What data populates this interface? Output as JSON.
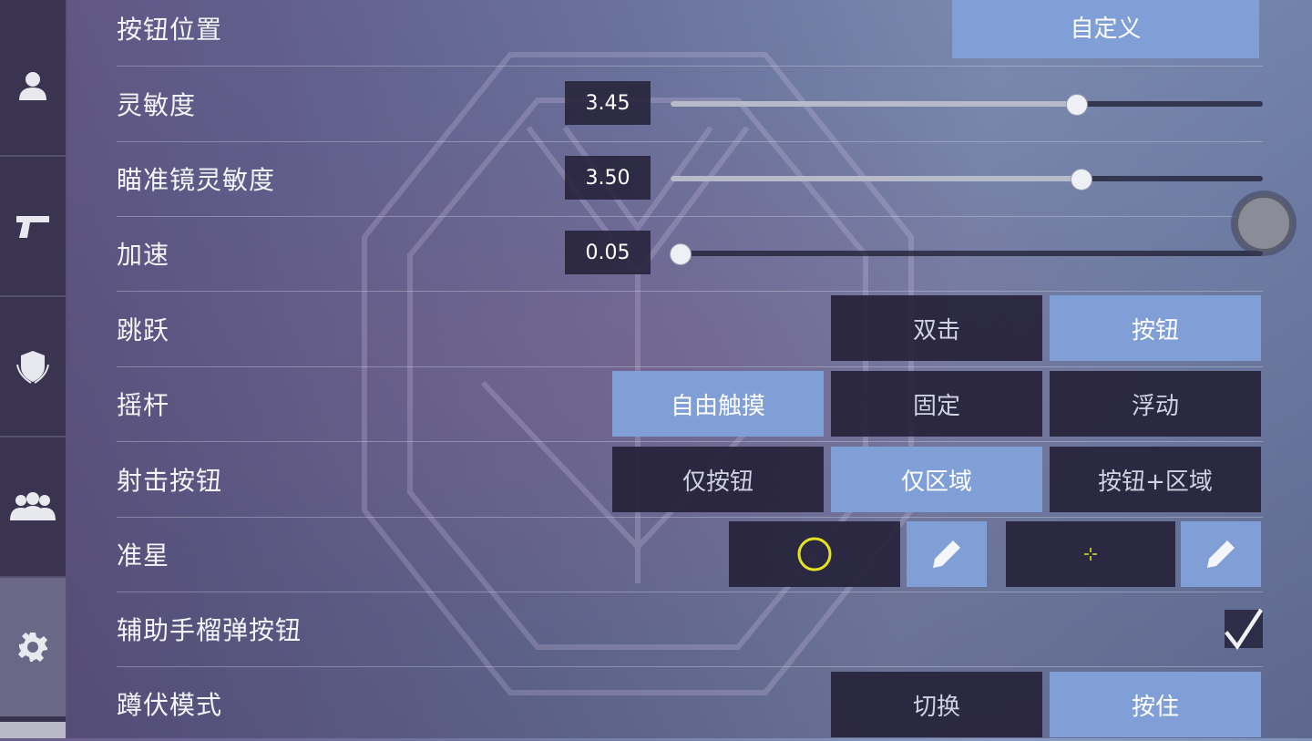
{
  "sidebar": {
    "items": [
      {
        "icon": "person-icon"
      },
      {
        "icon": "pistol-icon"
      },
      {
        "icon": "shield-icon"
      },
      {
        "icon": "group-icon"
      },
      {
        "icon": "gear-icon",
        "active": true
      }
    ]
  },
  "settings": {
    "button_position": {
      "label": "按钮位置",
      "value": "自定义"
    },
    "sensitivity": {
      "label": "灵敏度",
      "value": "3.45",
      "fraction": 0.685
    },
    "scope_sensitivity": {
      "label": "瞄准镜灵敏度",
      "value": "3.50",
      "fraction": 0.693
    },
    "acceleration": {
      "label": "加速",
      "value": "0.05",
      "fraction": 0.015
    },
    "jump": {
      "label": "跳跃",
      "options": [
        "双击",
        "按钮"
      ],
      "selected": "按钮"
    },
    "joystick": {
      "label": "摇杆",
      "options": [
        "自由触摸",
        "固定",
        "浮动"
      ],
      "selected": "自由触摸"
    },
    "fire_button": {
      "label": "射击按钮",
      "options": [
        "仅按钮",
        "仅区域",
        "按钮+区域"
      ],
      "selected": "仅区域"
    },
    "crosshair": {
      "label": "准星",
      "option1_icon": "circle-crosshair-icon",
      "option2_icon": "dot-crosshair-icon",
      "edit_icon": "pencil-icon",
      "crosshair_color": "#e6e61e"
    },
    "grenade_button": {
      "label": "辅助手榴弹按钮",
      "checked": true
    },
    "crouch_mode": {
      "label": "蹲伏模式",
      "options": [
        "切换",
        "按住"
      ],
      "selected": "按住"
    }
  },
  "colors": {
    "selected": "#7f9fd6",
    "unselected": "#26223a",
    "sidebar": "#3a3450"
  }
}
